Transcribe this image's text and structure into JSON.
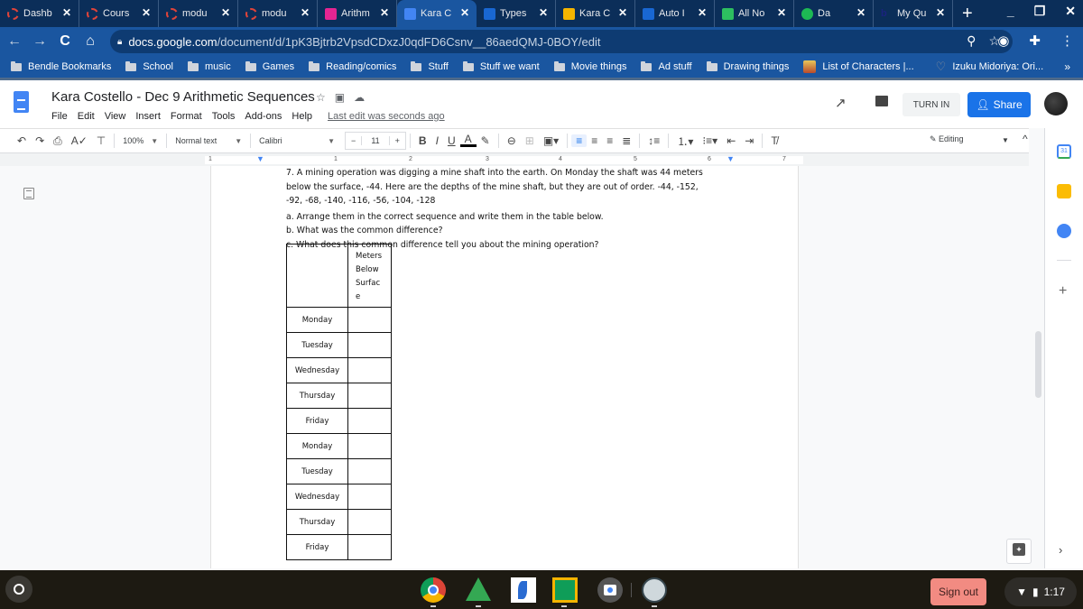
{
  "browser": {
    "tabs": [
      {
        "title": "Dashb",
        "icon": "loading-ring-icon",
        "active": false
      },
      {
        "title": "Cours",
        "icon": "loading-ring-icon",
        "active": false
      },
      {
        "title": "modu",
        "icon": "loading-ring-icon",
        "active": false
      },
      {
        "title": "modu",
        "icon": "loading-ring-icon",
        "active": false
      },
      {
        "title": "Arithm",
        "icon": "classroom-assignment-icon",
        "active": false
      },
      {
        "title": "Kara C",
        "icon": "google-docs-icon",
        "active": true
      },
      {
        "title": "Types",
        "icon": "classroom-assignment-icon",
        "active": false
      },
      {
        "title": "Kara C",
        "icon": "google-slides-icon",
        "active": false
      },
      {
        "title": "Auto I",
        "icon": "classroom-assignment-icon",
        "active": false
      },
      {
        "title": "All No",
        "icon": "evernote-icon",
        "active": false
      },
      {
        "title": "Da",
        "icon": "spotify-icon",
        "active": false
      },
      {
        "title": "My Qu",
        "icon": "b-logo-icon",
        "active": false
      }
    ],
    "close_glyph": "✕",
    "new_tab": "+",
    "window_controls": {
      "minimize": "_",
      "restore": "❐",
      "close": "✕"
    },
    "url_host": "docs.google.com",
    "url_path": "/document/d/1pK3Bjtrb2VpsdCDxzJ0qdFD6Csnv__86aedQMJ-0BOY/edit",
    "nav": {
      "back": "←",
      "forward": "→",
      "reload": "C",
      "home": "⌂"
    },
    "bookmarks": [
      {
        "label": "Bendle Bookmarks",
        "type": "folder"
      },
      {
        "label": "School",
        "type": "folder"
      },
      {
        "label": "music",
        "type": "folder"
      },
      {
        "label": "Games",
        "type": "folder"
      },
      {
        "label": "Reading/comics",
        "type": "folder"
      },
      {
        "label": "Stuff",
        "type": "folder"
      },
      {
        "label": "Stuff we want",
        "type": "folder"
      },
      {
        "label": "Movie things",
        "type": "folder"
      },
      {
        "label": "Ad stuff",
        "type": "folder"
      },
      {
        "label": "Drawing things",
        "type": "folder"
      },
      {
        "label": "List of Characters |...",
        "type": "page"
      },
      {
        "label": "Izuku Midoriya: Ori...",
        "type": "page"
      }
    ],
    "bookmarks_more": "»"
  },
  "docs": {
    "title": "Kara Costello - Dec 9 Arithmetic Sequences",
    "menu": [
      "File",
      "Edit",
      "View",
      "Insert",
      "Format",
      "Tools",
      "Add-ons",
      "Help"
    ],
    "last_edit": "Last edit was seconds ago",
    "turn_in": "TURN IN",
    "share": "Share",
    "toolbar": {
      "zoom": "100%",
      "style": "Normal text",
      "font": "Calibri",
      "font_size": "11",
      "minus": "−",
      "plus": "+",
      "mode": "Editing"
    },
    "ruler_numbers": [
      "1",
      "1",
      "2",
      "3",
      "4",
      "5",
      "6",
      "7"
    ]
  },
  "document": {
    "question_lines": [
      "7. A mining operation was digging a mine shaft into the earth. On Monday the shaft was 44 meters",
      "below the surface, -44. Here are the depths of the mine shaft, but they are out of order.  -44, -152,",
      "-92, -68, -140, -116, -56, -104, -128"
    ],
    "part_a": " a. Arrange them in the correct sequence and write them in the table below.",
    "part_b": "b. What was the common difference?",
    "part_c": "c. What does this common difference tell you about the mining operation?",
    "table": {
      "header": [
        "",
        "Meters",
        "Below",
        "Surfac",
        "e"
      ],
      "rows": [
        "Monday",
        "Tuesday",
        "Wednesday",
        "Thursday",
        "Friday",
        "Monday",
        "Tuesday",
        "Wednesday",
        "Thursday",
        "Friday"
      ]
    }
  },
  "shelf": {
    "apps": [
      "chrome-icon",
      "google-drive-icon",
      "app-feather-icon",
      "google-classroom-icon",
      "camera-icon",
      "owl-app-icon"
    ],
    "sign_out": "Sign out",
    "time": "1:17"
  }
}
